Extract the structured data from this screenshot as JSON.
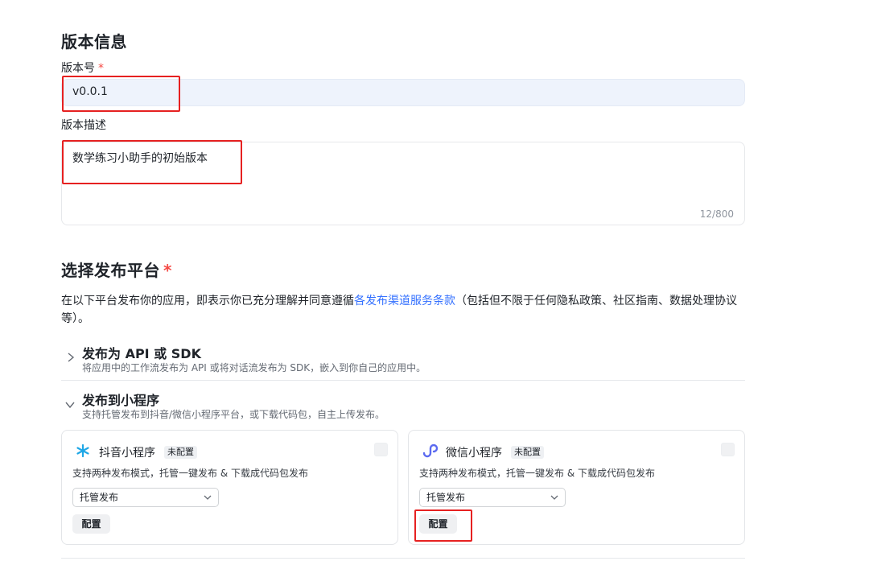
{
  "version_info": {
    "title": "版本信息",
    "version_label": "版本号",
    "required_mark": "*",
    "version_value": "v0.0.1",
    "desc_label": "版本描述",
    "desc_value": "数学练习小助手的初始版本",
    "desc_counter": "12/800"
  },
  "platform": {
    "title": "选择发布平台",
    "required_mark": "*",
    "desc_before": "在以下平台发布你的应用，即表示你已充分理解并同意遵循",
    "desc_link": "各发布渠道服务条款",
    "desc_after": "（包括但不限于任何隐私政策、社区指南、数据处理协议等）。",
    "sections": [
      {
        "chevron": "›",
        "title": "发布为 API 或 SDK",
        "subtitle": "将应用中的工作流发布为 API 或将对话流发布为 SDK，嵌入到你自己的应用中。"
      },
      {
        "chevron": "⌄",
        "title": "发布到小程序",
        "subtitle": "支持托管发布到抖音/微信小程序平台，或下载代码包，自主上传发布。"
      }
    ],
    "cards": [
      {
        "icon": "douyin-icon",
        "name": "抖音小程序",
        "badge": "未配置",
        "desc": "支持两种发布模式，托管一键发布 & 下载成代码包发布",
        "select_value": "托管发布",
        "button": "配置"
      },
      {
        "icon": "wechat-miniprogram-icon",
        "name": "微信小程序",
        "badge": "未配置",
        "desc": "支持两种发布模式，托管一键发布 & 下载成代码包发布",
        "select_value": "托管发布",
        "button": "配置"
      }
    ]
  },
  "colors": {
    "accent": "#3370ff",
    "required": "#f54a45",
    "highlight": "#e62121",
    "wechat": "#5b6af0",
    "douyin": "#1fa7e6"
  }
}
